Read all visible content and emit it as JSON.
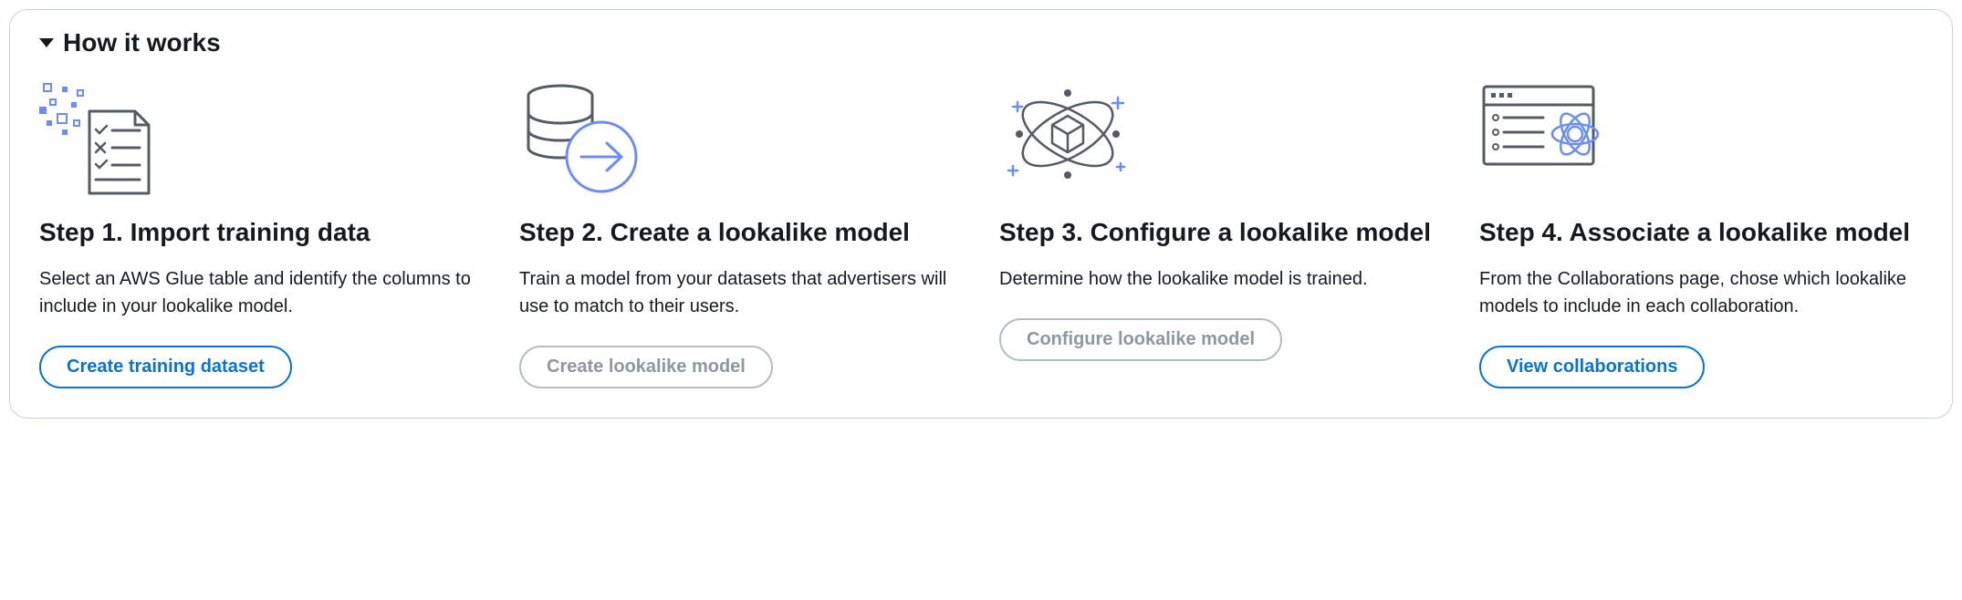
{
  "header": {
    "title": "How it works"
  },
  "steps": [
    {
      "title": "Step 1. Import training data",
      "description": "Select an AWS Glue table and identify the columns to include in your lookalike model.",
      "button": "Create training dataset",
      "button_enabled": true
    },
    {
      "title": "Step 2. Create a lookalike model",
      "description": "Train a model from your datasets that advertisers will use to match to their users.",
      "button": "Create lookalike model",
      "button_enabled": false
    },
    {
      "title": "Step 3. Configure a lookalike model",
      "description": "Determine how the lookalike model is trained.",
      "button": "Configure lookalike model",
      "button_enabled": false
    },
    {
      "title": "Step 4. Associate a lookalike model",
      "description": "From the Collaborations page, chose which lookalike models to include in each collaboration.",
      "button": "View collaborations",
      "button_enabled": true
    }
  ]
}
